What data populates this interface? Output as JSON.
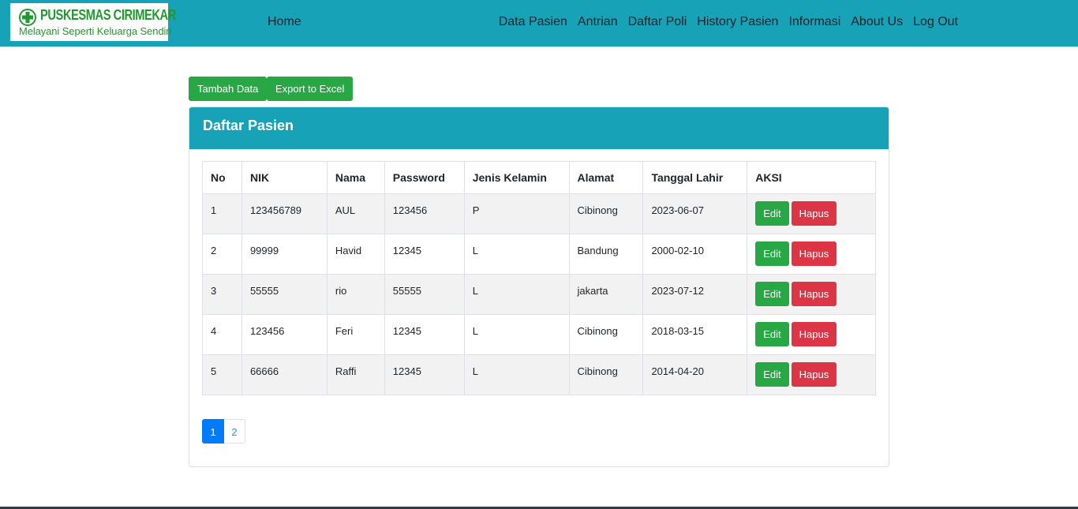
{
  "brand": {
    "title": "PUSKESMAS CIRIMEKAR",
    "tagline": "Melayani Seperti Keluarga Sendiri",
    "color": "#1f9a2e"
  },
  "nav": {
    "home": "Home",
    "items": [
      "Data Pasien",
      "Antrian",
      "Daftar Poli",
      "History Pasien",
      "Informasi",
      "About Us",
      "Log Out"
    ]
  },
  "actions": {
    "add_label": "Tambah Data",
    "export_label": "Export to Excel"
  },
  "card": {
    "title": "Daftar Pasien"
  },
  "table": {
    "headers": [
      "No",
      "NIK",
      "Nama",
      "Password",
      "Jenis Kelamin",
      "Alamat",
      "Tanggal Lahir",
      "AKSI"
    ],
    "rows": [
      [
        "1",
        "123456789",
        "AUL",
        "123456",
        "P",
        "Cibinong",
        "2023-06-07"
      ],
      [
        "2",
        "99999",
        "Havid",
        "12345",
        "L",
        "Bandung",
        "2000-02-10"
      ],
      [
        "3",
        "55555",
        "rio",
        "55555",
        "L",
        "jakarta",
        "2023-07-12"
      ],
      [
        "4",
        "123456",
        "Feri",
        "12345",
        "L",
        "Cibinong",
        "2018-03-15"
      ],
      [
        "5",
        "66666",
        "Raffi",
        "12345",
        "L",
        "Cibinong",
        "2014-04-20"
      ]
    ],
    "edit_label": "Edit",
    "delete_label": "Hapus"
  },
  "pagination": {
    "pages": [
      "1",
      "2"
    ],
    "current": "1"
  },
  "colors": {
    "navbar": "#17a2b8",
    "success": "#28a745",
    "danger": "#dc3545",
    "primary": "#007bff"
  }
}
